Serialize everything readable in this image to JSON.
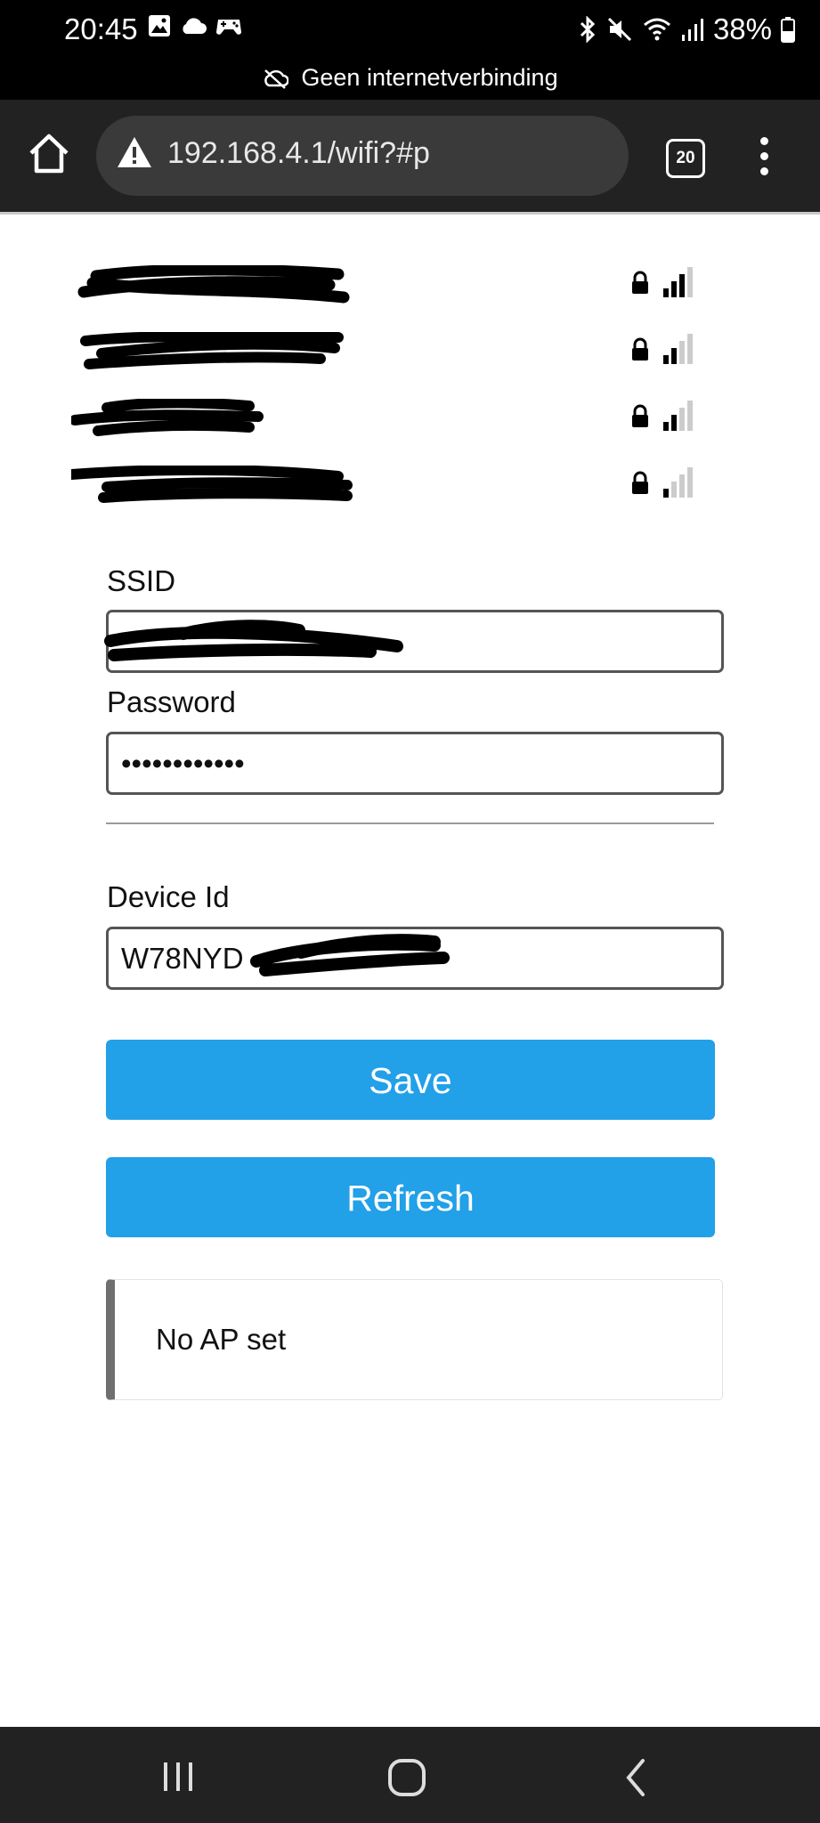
{
  "status_bar": {
    "time": "20:45",
    "battery": "38%",
    "network_message": "Geen internetverbinding",
    "left_icons": [
      "image-icon",
      "cloud-icon",
      "game-icon"
    ],
    "right_icons": [
      "bluetooth-icon",
      "mute-icon",
      "wifi-icon",
      "cell-signal-icon",
      "battery-icon"
    ]
  },
  "browser": {
    "url": "192.168.4.1/wifi?#p",
    "tab_count": "20"
  },
  "networks": [
    {
      "name": "[redacted]",
      "secured": true,
      "signal_bars": 3
    },
    {
      "name": "[redacted]",
      "secured": true,
      "signal_bars": 2
    },
    {
      "name": "[redacted]",
      "secured": true,
      "signal_bars": 2
    },
    {
      "name": "[redacted]",
      "secured": true,
      "signal_bars": 1
    }
  ],
  "form": {
    "ssid_label": "SSID",
    "ssid_value": "",
    "password_label": "Password",
    "password_value": "••••••••••••",
    "device_id_label": "Device Id",
    "device_id_value": "W78NYD",
    "save_label": "Save",
    "refresh_label": "Refresh"
  },
  "message": "No AP set",
  "colors": {
    "button": "#22a0e8",
    "status_bar": "#000000",
    "toolbar": "#222222"
  }
}
